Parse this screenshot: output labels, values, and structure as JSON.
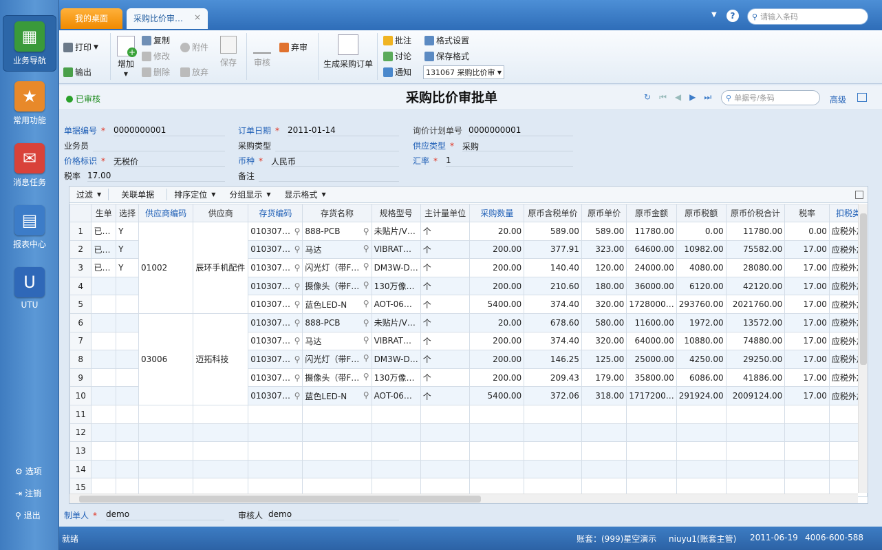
{
  "nav": {
    "items": [
      {
        "label": "业务导航",
        "icon": "business-nav-icon",
        "color": "#3a9a3a"
      },
      {
        "label": "常用功能",
        "icon": "star-icon",
        "color": "#e8892a"
      },
      {
        "label": "消息任务",
        "icon": "message-icon",
        "color": "#d9423a"
      },
      {
        "label": "报表中心",
        "icon": "report-icon",
        "color": "#3c7cc8"
      },
      {
        "label": "UTU",
        "icon": "utu-icon",
        "color": "#2f68b8"
      }
    ],
    "bottom": [
      {
        "label": "选项"
      },
      {
        "label": "注销"
      },
      {
        "label": "退出"
      }
    ]
  },
  "tabs": {
    "desk": "我的桌面",
    "cmp": "采购比价审…",
    "close": "×"
  },
  "search": {
    "placeholder": "请输入条码"
  },
  "toolbar": {
    "print": "打印",
    "output": "输出",
    "add": "增加",
    "copy": "复制",
    "edit": "修改",
    "delete": "删除",
    "attach": "附件",
    "discard": "放弃",
    "save": "保存",
    "review": "审核",
    "abandon": "弃审",
    "gen_po": "生成采购订单",
    "annotate": "批注",
    "discuss": "讨论",
    "notify": "通知",
    "format_set": "格式设置",
    "save_format": "保存格式",
    "format_select": "131067 采购比价审"
  },
  "doc": {
    "status": "已审核",
    "title": "采购比价审批单",
    "nav_search_placeholder": "单据号/条码",
    "advanced": "高级"
  },
  "form": {
    "doc_no_label": "单据编号",
    "doc_no": "0000000001",
    "order_date_label": "订单日期",
    "order_date": "2011-01-14",
    "inquiry_label": "询价计划单号",
    "inquiry": "0000000001",
    "salesman_label": "业务员",
    "salesman": "",
    "ptype_label": "采购类型",
    "ptype": "",
    "stype_label": "供应类型",
    "stype": "采购",
    "price_label": "价格标识",
    "price": "无税价",
    "currency_label": "币种",
    "currency": "人民币",
    "rate_label": "汇率",
    "rate": "1",
    "tax_label": "税率",
    "tax": "17.00",
    "note_label": "备注",
    "note": ""
  },
  "gridtools": [
    "过滤",
    "关联单据",
    "排序定位",
    "分组显示",
    "显示格式"
  ],
  "columns": [
    "",
    "生单",
    "选择",
    "供应商编码",
    "供应商",
    "存货编码",
    "存货名称",
    "规格型号",
    "主计量单位",
    "采购数量",
    "原币含税单价",
    "原币单价",
    "原币金额",
    "原币税额",
    "原币价税合计",
    "税率",
    "扣税类"
  ],
  "rows": [
    [
      "1",
      "已…",
      "Y",
      "010307…",
      "888-PCB",
      "未贴片/V…",
      "个",
      "20.00",
      "589.00",
      "589.00",
      "11780.00",
      "0.00",
      "11780.00",
      "0.00",
      "应税外加"
    ],
    [
      "2",
      "已…",
      "Y",
      "010307…",
      "马达",
      "VIBRAT…",
      "个",
      "200.00",
      "377.91",
      "323.00",
      "64600.00",
      "10982.00",
      "75582.00",
      "17.00",
      "应税外加"
    ],
    [
      "3",
      "已…",
      "Y",
      "010307…",
      "闪光灯（带F…",
      "DM3W-D…",
      "个",
      "200.00",
      "140.40",
      "120.00",
      "24000.00",
      "4080.00",
      "28080.00",
      "17.00",
      "应税外加"
    ],
    [
      "4",
      "",
      "",
      "010307…",
      "摄像头（带F…",
      "130万像…",
      "个",
      "200.00",
      "210.60",
      "180.00",
      "36000.00",
      "6120.00",
      "42120.00",
      "17.00",
      "应税外加"
    ],
    [
      "5",
      "",
      "",
      "010307…",
      "蓝色LED-N",
      "AOT-06…",
      "个",
      "5400.00",
      "374.40",
      "320.00",
      "1728000…",
      "293760.00",
      "2021760.00",
      "17.00",
      "应税外加"
    ],
    [
      "6",
      "",
      "",
      "010307…",
      "888-PCB",
      "未贴片/V…",
      "个",
      "20.00",
      "678.60",
      "580.00",
      "11600.00",
      "1972.00",
      "13572.00",
      "17.00",
      "应税外加"
    ],
    [
      "7",
      "",
      "",
      "010307…",
      "马达",
      "VIBRAT…",
      "个",
      "200.00",
      "374.40",
      "320.00",
      "64000.00",
      "10880.00",
      "74880.00",
      "17.00",
      "应税外加"
    ],
    [
      "8",
      "",
      "",
      "010307…",
      "闪光灯（带F…",
      "DM3W-D…",
      "个",
      "200.00",
      "146.25",
      "125.00",
      "25000.00",
      "4250.00",
      "29250.00",
      "17.00",
      "应税外加"
    ],
    [
      "9",
      "",
      "",
      "010307…",
      "摄像头（带F…",
      "130万像…",
      "个",
      "200.00",
      "209.43",
      "179.00",
      "35800.00",
      "6086.00",
      "41886.00",
      "17.00",
      "应税外加"
    ],
    [
      "10",
      "",
      "",
      "010307…",
      "蓝色LED-N",
      "AOT-06…",
      "个",
      "5400.00",
      "372.06",
      "318.00",
      "1717200…",
      "291924.00",
      "2009124.00",
      "17.00",
      "应税外加"
    ],
    [
      "11",
      "",
      "",
      "",
      "",
      "",
      "",
      "",
      "",
      "",
      "",
      "",
      "",
      "",
      ""
    ],
    [
      "12",
      "",
      "",
      "",
      "",
      "",
      "",
      "",
      "",
      "",
      "",
      "",
      "",
      "",
      ""
    ],
    [
      "13",
      "",
      "",
      "",
      "",
      "",
      "",
      "",
      "",
      "",
      "",
      "",
      "",
      "",
      ""
    ],
    [
      "14",
      "",
      "",
      "",
      "",
      "",
      "",
      "",
      "",
      "",
      "",
      "",
      "",
      "",
      ""
    ],
    [
      "15",
      "",
      "",
      "",
      "",
      "",
      "",
      "",
      "",
      "",
      "",
      "",
      "",
      "",
      ""
    ]
  ],
  "suppliers": [
    {
      "code": "01002",
      "name": "辰环手机配件"
    },
    {
      "code": "03006",
      "name": "迈拓科技"
    }
  ],
  "footer": {
    "maker_label": "制单人",
    "maker": "demo",
    "reviewer_label": "审核人",
    "reviewer": "demo"
  },
  "status": {
    "ready": "就绪",
    "account": "账套：(999)星空演示",
    "user": "niuyu1(账套主管)",
    "date": "2011-06-19",
    "phone": "4006-600-588"
  }
}
